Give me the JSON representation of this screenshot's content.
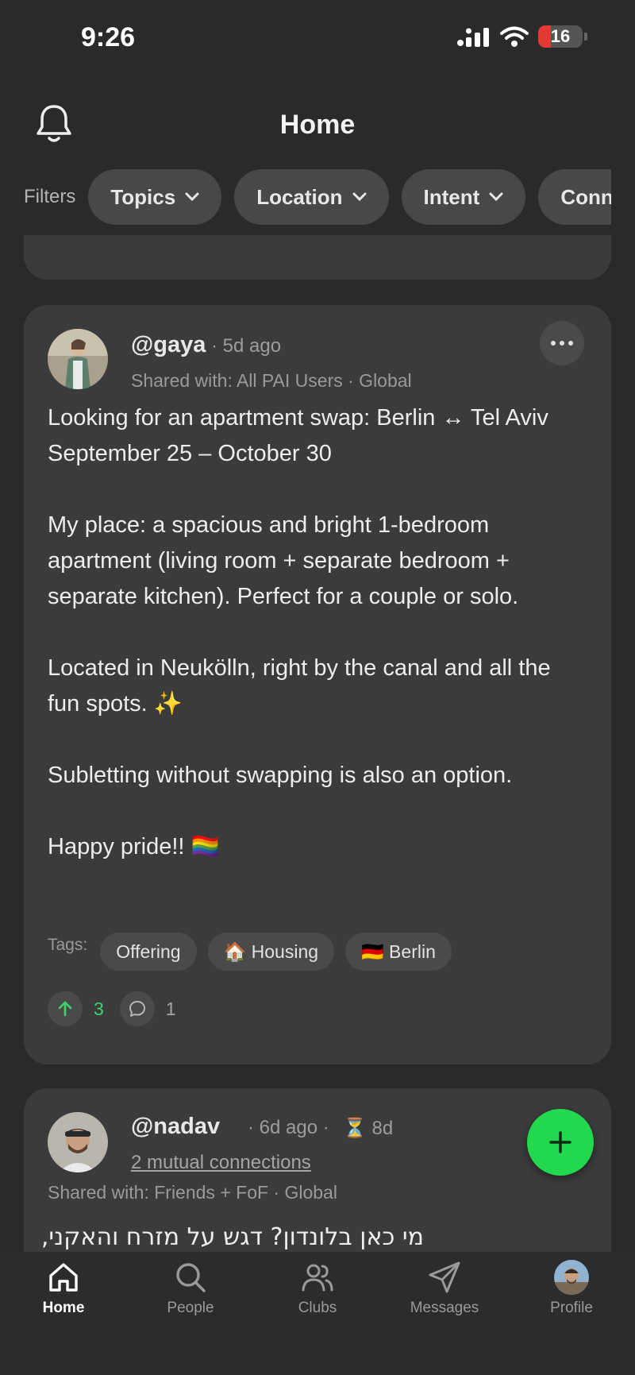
{
  "status_bar": {
    "time": "9:26",
    "battery": "16"
  },
  "header": {
    "title": "Home"
  },
  "filters": {
    "label": "Filters",
    "chips": [
      "Topics",
      "Location",
      "Intent",
      "Conn"
    ]
  },
  "posts": [
    {
      "username": "@gaya",
      "time": "· 5d ago",
      "shared": "Shared with: All PAI Users · Global",
      "body": [
        "Looking for an apartment swap: Berlin ↔ Tel Aviv",
        "September 25 – October 30",
        "",
        "My place: a spacious and bright 1-bedroom apartment (living room + separate bedroom + separate kitchen). Perfect for a couple or solo.",
        "",
        "Located in Neukölln, right by the canal and all the fun spots. ✨",
        "",
        "Subletting without swapping is also an option.",
        "",
        "Happy pride!! 🏳️‍🌈"
      ],
      "tags_label": "Tags:",
      "tags": [
        "Offering",
        "🏠 Housing",
        "🇩🇪 Berlin"
      ],
      "upvotes": "3",
      "comments": "1"
    },
    {
      "username": "@nadav",
      "time": "· 6d ago ·",
      "expiry": "⏳ 8d",
      "mutual": "2 mutual connections",
      "shared": "Shared with: Friends + FoF · Global",
      "body_preview": "מי כאן בלונדון? דגש על מזרח והאקני,"
    }
  ],
  "tabbar": {
    "home": "Home",
    "people": "People",
    "clubs": "Clubs",
    "messages": "Messages",
    "profile": "Profile"
  }
}
